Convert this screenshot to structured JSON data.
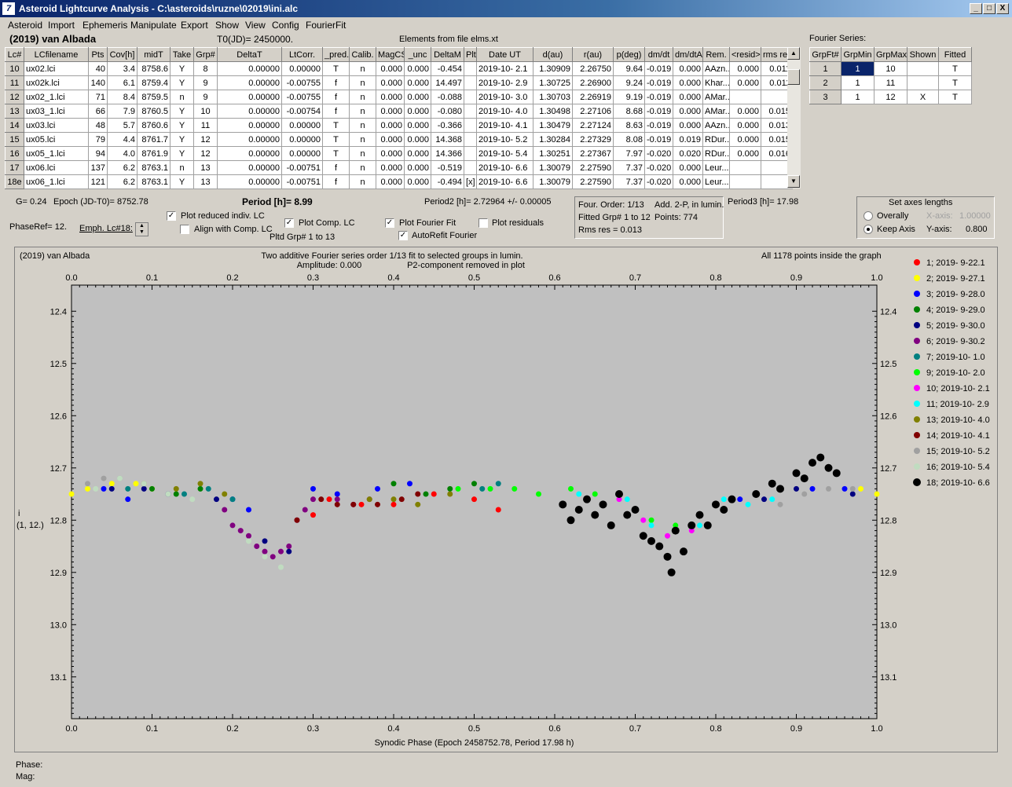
{
  "window": {
    "title": "Asteroid Lightcurve Analysis - C:\\asteroids\\ruzne\\02019\\ini.alc",
    "min": "_",
    "max": "□",
    "close": "X"
  },
  "menu": [
    "Asteroid",
    "Import",
    "Ephemeris",
    "Manipulate",
    "Export",
    "Show",
    "View",
    "Config",
    "FourierFit"
  ],
  "header": {
    "asteroid": "(2019) van Albada",
    "t0": "T0(JD)= 2450000.",
    "elements": "Elements from file elms.xt",
    "fourier_series": "Fourier Series:"
  },
  "lc_table": {
    "columns": [
      "Lc#",
      "LCfilename",
      "Pts",
      "Cov[h]",
      "midT",
      "Take",
      "Grp#",
      "DeltaT",
      "LtCorr.",
      "_pred.",
      "Calib.",
      "MagCS",
      "_unc",
      "DeltaM",
      "Plt",
      "Date UT",
      "d(au)",
      "r(au)",
      "p(deg)",
      "dm/dt",
      "dm/dtA",
      "Rem.",
      "<resid>",
      "rms res"
    ],
    "rows": [
      [
        "10",
        "ux02.lci",
        "40",
        "3.4",
        "8758.6",
        "Y",
        "8",
        "0.00000",
        "0.00000",
        "T",
        "n",
        "0.000",
        "0.000",
        "-0.454",
        "",
        "2019-10- 2.1",
        "1.30909",
        "2.26750",
        "9.64",
        "-0.019",
        "0.000",
        "AAzn...",
        "0.000",
        "0.011"
      ],
      [
        "11",
        "ux02k.lci",
        "140",
        "6.1",
        "8759.4",
        "Y",
        "9",
        "0.00000",
        "-0.00755",
        "f",
        "n",
        "0.000",
        "0.000",
        "14.497",
        "",
        "2019-10- 2.9",
        "1.30725",
        "2.26900",
        "9.24",
        "-0.019",
        "0.000",
        "Khar...",
        "0.000",
        "0.011"
      ],
      [
        "12",
        "ux02_1.lci",
        "71",
        "8.4",
        "8759.5",
        "n",
        "9",
        "0.00000",
        "-0.00755",
        "f",
        "n",
        "0.000",
        "0.000",
        "-0.088",
        "",
        "2019-10- 3.0",
        "1.30703",
        "2.26919",
        "9.19",
        "-0.019",
        "0.000",
        "AMar...",
        "",
        ""
      ],
      [
        "13",
        "ux03_1.lci",
        "66",
        "7.9",
        "8760.5",
        "Y",
        "10",
        "0.00000",
        "-0.00754",
        "f",
        "n",
        "0.000",
        "0.000",
        "-0.080",
        "",
        "2019-10- 4.0",
        "1.30498",
        "2.27106",
        "8.68",
        "-0.019",
        "0.000",
        "AMar...",
        "0.000",
        "0.015"
      ],
      [
        "14",
        "ux03.lci",
        "48",
        "5.7",
        "8760.6",
        "Y",
        "11",
        "0.00000",
        "0.00000",
        "T",
        "n",
        "0.000",
        "0.000",
        "-0.366",
        "",
        "2019-10- 4.1",
        "1.30479",
        "2.27124",
        "8.63",
        "-0.019",
        "0.000",
        "AAzn...",
        "0.000",
        "0.013"
      ],
      [
        "15",
        "ux05.lci",
        "79",
        "4.4",
        "8761.7",
        "Y",
        "12",
        "0.00000",
        "0.00000",
        "T",
        "n",
        "0.000",
        "0.000",
        "14.368",
        "",
        "2019-10- 5.2",
        "1.30284",
        "2.27329",
        "8.08",
        "-0.019",
        "0.019",
        "RDur...",
        "0.000",
        "0.015"
      ],
      [
        "16",
        "ux05_1.lci",
        "94",
        "4.0",
        "8761.9",
        "Y",
        "12",
        "0.00000",
        "0.00000",
        "T",
        "n",
        "0.000",
        "0.000",
        "14.366",
        "",
        "2019-10- 5.4",
        "1.30251",
        "2.27367",
        "7.97",
        "-0.020",
        "0.020",
        "RDur...",
        "0.000",
        "0.016"
      ],
      [
        "17",
        "ux06.lci",
        "137",
        "6.2",
        "8763.1",
        "n",
        "13",
        "0.00000",
        "-0.00751",
        "f",
        "n",
        "0.000",
        "0.000",
        "-0.519",
        "",
        "2019-10- 6.6",
        "1.30079",
        "2.27590",
        "7.37",
        "-0.020",
        "0.000",
        "Leur...",
        "",
        ""
      ],
      [
        "18e",
        "ux06_1.lci",
        "121",
        "6.2",
        "8763.1",
        "Y",
        "13",
        "0.00000",
        "-0.00751",
        "f",
        "n",
        "0.000",
        "0.000",
        "-0.494",
        "[x]",
        "2019-10- 6.6",
        "1.30079",
        "2.27590",
        "7.37",
        "-0.020",
        "0.000",
        "Leur...",
        "",
        ""
      ]
    ]
  },
  "fourier_table": {
    "columns": [
      "GrpFt#",
      "GrpMin",
      "GrpMax",
      "Shown",
      "Fitted"
    ],
    "rows": [
      [
        "1",
        "1",
        "10",
        "",
        "T"
      ],
      [
        "2",
        "1",
        "11",
        "",
        "T"
      ],
      [
        "3",
        "1",
        "12",
        "X",
        "T"
      ]
    ]
  },
  "controls": {
    "g": "G= 0.24",
    "epoch": "Epoch (JD-T0)= 8752.78",
    "period": "Period [h]= 8.99",
    "period2": "Period2 [h]= 2.72964 +/- 0.00005",
    "period3": "Period3 [h]= 17.98",
    "phaseref": "PhaseRef= 12.",
    "emph": "Emph. Lc#18:",
    "plot_reduced": "Plot reduced indiv. LC",
    "align": "Align with Comp. LC",
    "plot_comp": "Plot Comp. LC",
    "pltd_grp": "Pltd Grp#  1   to   13",
    "plot_fourier": "Plot Fourier Fit",
    "autorefit": "AutoRefit Fourier",
    "plot_residuals": "Plot residuals",
    "four_order": "Four. Order:  1/13",
    "add2p": "Add. 2-P, in lumin.",
    "fitted_grp": "Fitted Grp# 1 to 12",
    "points": "Points: 774",
    "rms": "Rms res     = 0.013",
    "axes_title": "Set axes lengths",
    "overally": "Overally",
    "keep_axis": "Keep Axis",
    "xaxis": "X-axis:",
    "xaxis_val": "1.00000",
    "yaxis": "Y-axis:",
    "yaxis_val": "0.800"
  },
  "plot": {
    "name": "(2019) van Albada",
    "line1": "Two additive Fourier series order 1/13 fit to selected groups in lumin.",
    "line2a": "Amplitude: 0.000",
    "line2b": "P2-component removed in plot",
    "inside": "All 1178 points inside the graph",
    "ylabel1": "i",
    "ylabel2": "(1, 12.)",
    "xlabel": "Synodic Phase (Epoch 2458752.78, Period 17.98 h)",
    "xticks": [
      "0.0",
      "0.1",
      "0.2",
      "0.3",
      "0.4",
      "0.5",
      "0.6",
      "0.7",
      "0.8",
      "0.9",
      "1.0"
    ],
    "yticks": [
      "12.4",
      "12.5",
      "12.6",
      "12.7",
      "12.8",
      "12.9",
      "13.0",
      "13.1"
    ]
  },
  "legend": [
    {
      "label": "1; 2019- 9-22.1",
      "color": "#ff0000"
    },
    {
      "label": "2; 2019- 9-27.1",
      "color": "#ffff00"
    },
    {
      "label": "3; 2019- 9-28.0",
      "color": "#0000ff"
    },
    {
      "label": "4; 2019- 9-29.0",
      "color": "#008000"
    },
    {
      "label": "5; 2019- 9-30.0",
      "color": "#000080"
    },
    {
      "label": "6; 2019- 9-30.2",
      "color": "#800080"
    },
    {
      "label": "7; 2019-10- 1.0",
      "color": "#008080"
    },
    {
      "label": "9; 2019-10- 2.0",
      "color": "#00ff00"
    },
    {
      "label": "10; 2019-10- 2.1",
      "color": "#ff00ff"
    },
    {
      "label": "11; 2019-10- 2.9",
      "color": "#00ffff"
    },
    {
      "label": "13; 2019-10- 4.0",
      "color": "#808000"
    },
    {
      "label": "14; 2019-10- 4.1",
      "color": "#800000"
    },
    {
      "label": "15; 2019-10- 5.2",
      "color": "#a0a0a0"
    },
    {
      "label": "16; 2019-10- 5.4",
      "color": "#c0dcc0"
    },
    {
      "label": "18; 2019-10- 6.6",
      "color": "#000000"
    }
  ],
  "status": {
    "phase": "Phase:",
    "mag": "Mag:"
  },
  "chart_data": {
    "type": "scatter",
    "xlim": [
      0,
      1
    ],
    "ylim": [
      12.35,
      13.18
    ],
    "y_inverted": true,
    "grid": false,
    "series": [
      {
        "name": "1; 2019- 9-22.1",
        "color": "#ff0000",
        "x": [
          0.3,
          0.32,
          0.36,
          0.4,
          0.45,
          0.5,
          0.53
        ],
        "y": [
          12.79,
          12.76,
          12.77,
          12.77,
          12.75,
          12.76,
          12.78
        ]
      },
      {
        "name": "2; 2019- 9-27.1",
        "color": "#ffff00",
        "x": [
          0.0,
          0.02,
          0.05,
          0.08,
          0.1,
          0.98,
          1.0
        ],
        "y": [
          12.75,
          12.74,
          12.73,
          12.73,
          12.74,
          12.74,
          12.75
        ]
      },
      {
        "name": "3; 2019- 9-28.0",
        "color": "#0000ff",
        "x": [
          0.04,
          0.07,
          0.2,
          0.22,
          0.3,
          0.33,
          0.38,
          0.42,
          0.83,
          0.92,
          0.96
        ],
        "y": [
          12.74,
          12.76,
          12.76,
          12.78,
          12.74,
          12.75,
          12.74,
          12.73,
          12.76,
          12.74,
          12.74
        ]
      },
      {
        "name": "4; 2019- 9-29.0",
        "color": "#008000",
        "x": [
          0.1,
          0.13,
          0.16,
          0.4,
          0.44,
          0.47,
          0.5
        ],
        "y": [
          12.74,
          12.75,
          12.74,
          12.73,
          12.75,
          12.74,
          12.73
        ]
      },
      {
        "name": "5; 2019- 9-30.0",
        "color": "#000080",
        "x": [
          0.05,
          0.09,
          0.12,
          0.18,
          0.24,
          0.27,
          0.86,
          0.9,
          0.97
        ],
        "y": [
          12.74,
          12.74,
          12.75,
          12.76,
          12.84,
          12.86,
          12.76,
          12.74,
          12.75
        ]
      },
      {
        "name": "6; 2019- 9-30.2",
        "color": "#800080",
        "x": [
          0.19,
          0.2,
          0.21,
          0.22,
          0.23,
          0.24,
          0.25,
          0.26,
          0.27,
          0.28,
          0.29,
          0.3,
          0.33,
          0.35,
          0.37
        ],
        "y": [
          12.78,
          12.81,
          12.82,
          12.83,
          12.85,
          12.86,
          12.87,
          12.86,
          12.85,
          12.8,
          12.78,
          12.76,
          12.76,
          12.77,
          12.76
        ]
      },
      {
        "name": "7; 2019-10- 1.0",
        "color": "#008080",
        "x": [
          0.07,
          0.14,
          0.17,
          0.2,
          0.51,
          0.53
        ],
        "y": [
          12.74,
          12.75,
          12.74,
          12.76,
          12.74,
          12.73
        ]
      },
      {
        "name": "9; 2019-10- 2.0",
        "color": "#00ff00",
        "x": [
          0.48,
          0.52,
          0.55,
          0.58,
          0.62,
          0.65,
          0.72,
          0.75
        ],
        "y": [
          12.74,
          12.74,
          12.74,
          12.75,
          12.74,
          12.75,
          12.8,
          12.81
        ]
      },
      {
        "name": "10; 2019-10- 2.1",
        "color": "#ff00ff",
        "x": [
          0.68,
          0.71,
          0.74,
          0.77
        ],
        "y": [
          12.76,
          12.8,
          12.83,
          12.82
        ]
      },
      {
        "name": "11; 2019-10- 2.9",
        "color": "#00ffff",
        "x": [
          0.63,
          0.66,
          0.69,
          0.72,
          0.75,
          0.78,
          0.81,
          0.84,
          0.87
        ],
        "y": [
          12.75,
          12.77,
          12.76,
          12.81,
          12.82,
          12.81,
          12.76,
          12.77,
          12.76
        ]
      },
      {
        "name": "13; 2019-10- 4.0",
        "color": "#808000",
        "x": [
          0.09,
          0.13,
          0.16,
          0.19,
          0.37,
          0.4,
          0.43,
          0.47
        ],
        "y": [
          12.73,
          12.74,
          12.73,
          12.75,
          12.76,
          12.76,
          12.77,
          12.75
        ]
      },
      {
        "name": "14; 2019-10- 4.1",
        "color": "#800000",
        "x": [
          0.28,
          0.31,
          0.33,
          0.35,
          0.38,
          0.41,
          0.43
        ],
        "y": [
          12.8,
          12.76,
          12.77,
          12.77,
          12.77,
          12.76,
          12.75
        ]
      },
      {
        "name": "15; 2019-10- 5.2",
        "color": "#a0a0a0",
        "x": [
          0.02,
          0.04,
          0.06,
          0.88,
          0.91,
          0.94,
          0.97
        ],
        "y": [
          12.73,
          12.72,
          12.72,
          12.77,
          12.75,
          12.74,
          12.74
        ]
      },
      {
        "name": "16; 2019-10- 5.4",
        "color": "#c0dcc0",
        "x": [
          0.03,
          0.06,
          0.09,
          0.12,
          0.15,
          0.22,
          0.24,
          0.26
        ],
        "y": [
          12.74,
          12.72,
          12.73,
          12.75,
          12.76,
          12.84,
          12.87,
          12.89
        ]
      },
      {
        "name": "18; 2019-10- 6.6",
        "color": "#000000",
        "x": [
          0.61,
          0.62,
          0.63,
          0.64,
          0.65,
          0.66,
          0.67,
          0.68,
          0.69,
          0.7,
          0.71,
          0.72,
          0.73,
          0.74,
          0.745,
          0.75,
          0.76,
          0.77,
          0.78,
          0.79,
          0.8,
          0.81,
          0.82,
          0.85,
          0.87,
          0.88,
          0.9,
          0.91,
          0.92,
          0.93,
          0.94,
          0.95
        ],
        "y": [
          12.77,
          12.8,
          12.78,
          12.76,
          12.79,
          12.77,
          12.81,
          12.75,
          12.79,
          12.78,
          12.83,
          12.84,
          12.85,
          12.87,
          12.9,
          12.82,
          12.86,
          12.81,
          12.79,
          12.81,
          12.77,
          12.78,
          12.76,
          12.75,
          12.73,
          12.74,
          12.71,
          12.72,
          12.69,
          12.68,
          12.7,
          12.71
        ]
      }
    ]
  }
}
